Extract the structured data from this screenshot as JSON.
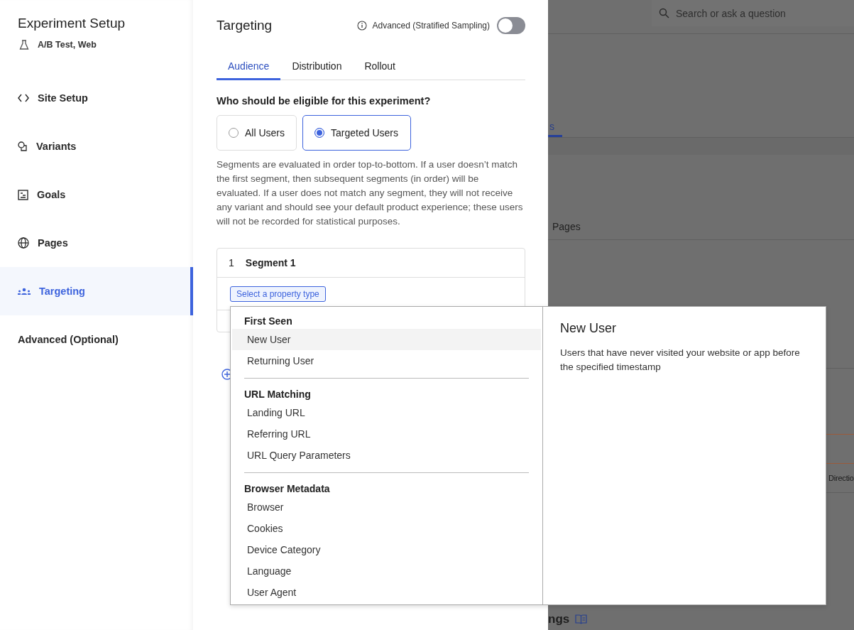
{
  "sidebar": {
    "title": "Experiment Setup",
    "subtitle": "A/B Test, Web",
    "items": [
      {
        "label": "Site Setup",
        "selected": false
      },
      {
        "label": "Variants",
        "selected": false
      },
      {
        "label": "Goals",
        "selected": false
      },
      {
        "label": "Pages",
        "selected": false
      },
      {
        "label": "Targeting",
        "selected": true
      },
      {
        "label": "Advanced (Optional)",
        "selected": false
      }
    ]
  },
  "panel": {
    "title": "Targeting",
    "toggle": {
      "label": "Advanced (Stratified Sampling)",
      "on": false
    },
    "tabs": [
      {
        "label": "Audience",
        "selected": true
      },
      {
        "label": "Distribution",
        "selected": false
      },
      {
        "label": "Rollout",
        "selected": false
      }
    ],
    "question": "Who should be eligible for this experiment?",
    "options": [
      {
        "label": "All Users",
        "selected": false
      },
      {
        "label": "Targeted Users",
        "selected": true
      }
    ],
    "description": "Segments are evaluated in order top-to-bottom. If a user doesn’t match the first segment, then subsequent segments (in order) will be evaluated. If a user does not match any segment, they will not receive any variant and should see your default product experience; these users will not be recorded for statistical purposes.",
    "segment": {
      "number": "1",
      "name": "Segment 1",
      "button": "Select a property type"
    }
  },
  "dropdown": {
    "groups": [
      {
        "heading": "First Seen",
        "items": [
          {
            "label": "New User",
            "selected": true
          },
          {
            "label": "Returning User",
            "selected": false
          }
        ]
      },
      {
        "heading": "URL Matching",
        "items": [
          {
            "label": "Landing URL",
            "selected": false
          },
          {
            "label": "Referring URL",
            "selected": false
          },
          {
            "label": "URL Query Parameters",
            "selected": false
          }
        ]
      },
      {
        "heading": "Browser Metadata",
        "items": [
          {
            "label": "Browser",
            "selected": false
          },
          {
            "label": "Cookies",
            "selected": false
          },
          {
            "label": "Device Category",
            "selected": false
          },
          {
            "label": "Language",
            "selected": false
          },
          {
            "label": "User Agent",
            "selected": false
          }
        ]
      }
    ],
    "detail": {
      "title": "New User",
      "text": "Users that have never visited your website or app before the specified timestamp"
    }
  },
  "background": {
    "search_placeholder": "Search or ask a question",
    "tab_fragment": "s",
    "column_fragment": "Pages",
    "header_fragment": "Directio",
    "heading_fragment": "ngs"
  }
}
